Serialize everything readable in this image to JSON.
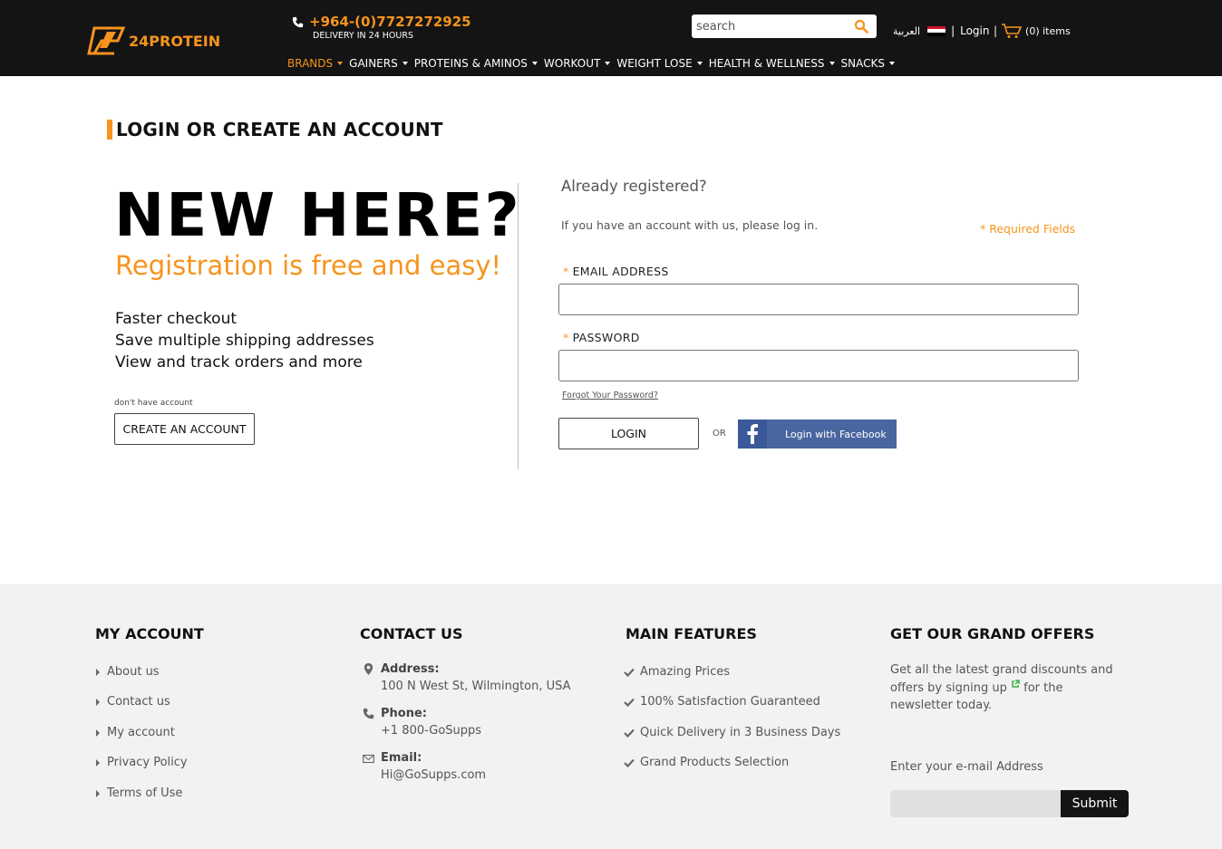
{
  "header": {
    "logo_text": "24PROTEIN",
    "phone": "+964-(0)7727272925",
    "delivery": "DELIVERY IN 24 HOURS",
    "search_placeholder": "search",
    "language": "العربية",
    "login": "Login",
    "cart": "(0) items",
    "brand_color": "#f7941d"
  },
  "nav": {
    "items": [
      {
        "label": "BRANDS"
      },
      {
        "label": "GAINERS"
      },
      {
        "label": "PROTEINS & AMINOS"
      },
      {
        "label": "WORKOUT"
      },
      {
        "label": "WEIGHT LOSE"
      },
      {
        "label": "HEALTH & WELLNESS"
      },
      {
        "label": "SNACKS"
      }
    ]
  },
  "page": {
    "title": "LOGIN OR CREATE AN ACCOUNT"
  },
  "new_customer": {
    "headline": "NEW HERE?",
    "subhead": "Registration is free and easy!",
    "benefits": [
      "Faster checkout",
      "Save multiple shipping addresses",
      "View and track orders and more"
    ],
    "no_account": "don't have account",
    "create_button": "CREATE AN ACCOUNT"
  },
  "login": {
    "heading": "Already registered?",
    "intro": "If you have an account with us, please log in.",
    "required": "* Required Fields",
    "email_label": "EMAIL ADDRESS",
    "password_label": "PASSWORD",
    "required_mark": "*",
    "email_value": "",
    "password_value": "",
    "forgot": "Forgot Your Password?",
    "login_button": "LOGIN",
    "or": "OR",
    "facebook_button": "Login with Facebook"
  },
  "footer": {
    "my_account": {
      "heading": "MY ACCOUNT",
      "links": [
        "About us",
        "Contact us",
        "My account",
        "Privacy Policy",
        "Terms of Use"
      ]
    },
    "contact": {
      "heading": "CONTACT US",
      "address_label": "Address:",
      "address": "100 N West St, Wilmington, USA",
      "phone_label": "Phone:",
      "phone": "+1 800-GoSupps",
      "email_label": "Email:",
      "email": "Hi@GoSupps.com"
    },
    "features": {
      "heading": "MAIN FEATURES",
      "items": [
        "Amazing Prices",
        "100% Satisfaction Guaranteed",
        "Quick Delivery in 3 Business Days",
        "Grand Products Selection"
      ]
    },
    "offers": {
      "heading": "GET OUR GRAND OFFERS",
      "text_before": "Get all the latest grand discounts and offers by signing up",
      "text_after": " for the newsletter today.",
      "email_label": "Enter your e-mail Address",
      "email_value": "",
      "submit": "Submit"
    }
  }
}
